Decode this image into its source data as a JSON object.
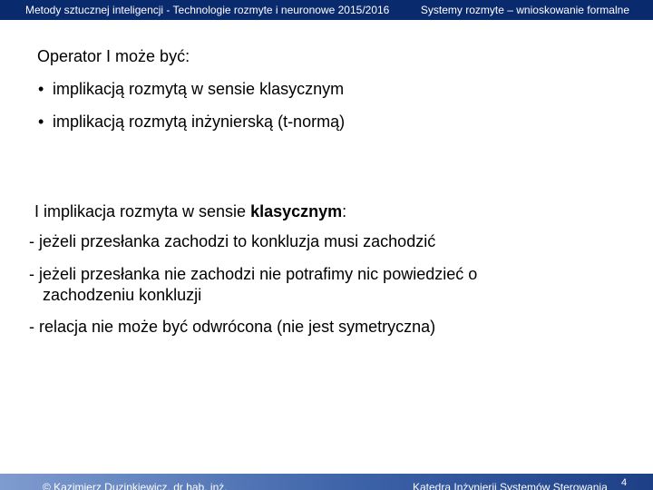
{
  "header": {
    "left_text": "Metody sztucznej inteligencji - Technologie rozmyte i neuronowe 2015/2016",
    "right_text": "Systemy rozmyte – wnioskowanie formalne"
  },
  "section1": {
    "title": "Operator I może być:",
    "bullets": [
      "implikacją rozmytą w sensie klasycznym",
      "implikacją rozmytą inżynierską (t-normą)"
    ],
    "bullet_glyph": "•"
  },
  "section2": {
    "intro_normal": "I implikacja rozmyta w sensie ",
    "intro_bold": "klasycznym",
    "intro_end": ":",
    "items": [
      "- jeżeli przesłanka zachodzi to konkluzja musi zachodzić",
      "- jeżeli przesłanka nie zachodzi nie potrafimy nic powiedzieć o",
      "zachodzeniu konkluzji",
      "-  relacja nie może być odwrócona (nie jest symetryczna)"
    ]
  },
  "footer": {
    "left_text": "© Kazimierz Duzinkiewicz, dr hab. inż.",
    "right_text": "Katedra Inżynierii Systemów Sterowania",
    "page_number": "4"
  },
  "colors": {
    "header_bg": "#0a2a6e",
    "footer_bg": "#3c62a8"
  }
}
